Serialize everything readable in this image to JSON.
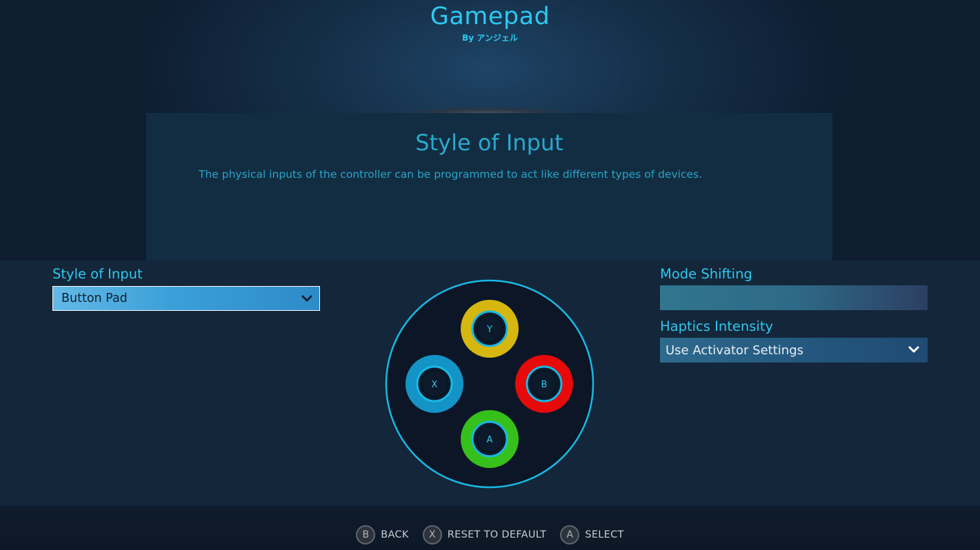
{
  "header": {
    "title": "Gamepad",
    "author": "By アンジェル"
  },
  "info": {
    "title": "Style of Input",
    "description": "The physical inputs of the controller can be programmed to act like different types of devices."
  },
  "style_of_input": {
    "label": "Style of Input",
    "value": "Button Pad",
    "icon": "chevron-down-icon"
  },
  "mode_shifting": {
    "label": "Mode Shifting"
  },
  "haptics": {
    "label": "Haptics Intensity",
    "value": "Use Activator Settings",
    "icon": "chevron-down-icon"
  },
  "button_pad": {
    "buttons": [
      {
        "label": "Y",
        "color": "#d6b70f"
      },
      {
        "label": "X",
        "color": "#1494c6"
      },
      {
        "label": "B",
        "color": "#e60a0a"
      },
      {
        "label": "A",
        "color": "#36c01c"
      }
    ],
    "accent": "#1ab8e4"
  },
  "footer": {
    "items": [
      {
        "glyph": "B",
        "label": "BACK"
      },
      {
        "glyph": "X",
        "label": "RESET TO DEFAULT"
      },
      {
        "glyph": "A",
        "label": "SELECT"
      }
    ]
  }
}
